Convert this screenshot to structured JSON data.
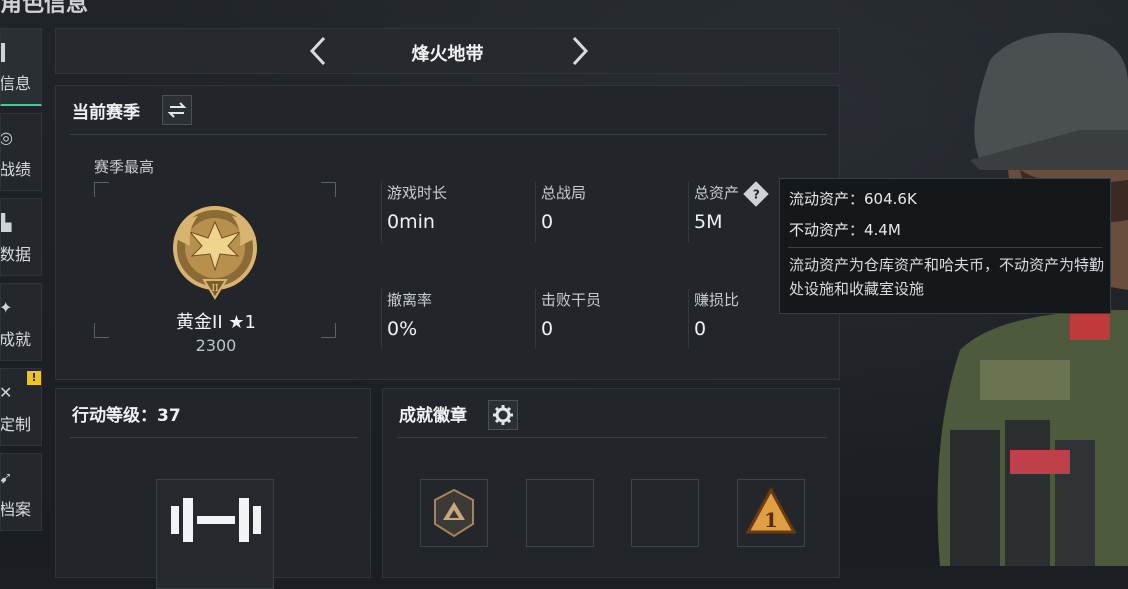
{
  "page": {
    "title": "角色信息"
  },
  "sidenav": {
    "items": [
      {
        "label": "信息",
        "icon": "info-icon",
        "active": true
      },
      {
        "label": "战绩",
        "icon": "target-icon"
      },
      {
        "label": "数据",
        "icon": "data-icon"
      },
      {
        "label": "成就",
        "icon": "star-icon"
      },
      {
        "label": "定制",
        "icon": "wrench-icon",
        "warning": "!"
      },
      {
        "label": "档案",
        "icon": "file-icon"
      }
    ]
  },
  "mode_bar": {
    "name": "烽火地带"
  },
  "season": {
    "title": "当前赛季",
    "best_label": "赛季最高",
    "rank_name": "黄金II ★1",
    "rank_score": "2300",
    "stats": [
      {
        "label": "游戏时长",
        "value": "0min"
      },
      {
        "label": "总战局",
        "value": "0"
      },
      {
        "label": "总资产",
        "value": "5M",
        "help": "?"
      },
      {
        "label": "撤离率",
        "value": "0%"
      },
      {
        "label": "击败干员",
        "value": "0"
      },
      {
        "label": "赚损比",
        "value": "0"
      }
    ]
  },
  "tooltip": {
    "liquid": "流动资产：604.6K",
    "fixed": "不动资产：4.4M",
    "description": "流动资产为仓库资产和哈夫币，不动资产为特勤处设施和收藏室设施"
  },
  "level_panel": {
    "title": "行动等级：37"
  },
  "badges_panel": {
    "title": "成就徽章"
  },
  "colors": {
    "accent_green": "#3ccf8e",
    "warning_yellow": "#f0c419",
    "medal_gold": "#c9a25a"
  }
}
